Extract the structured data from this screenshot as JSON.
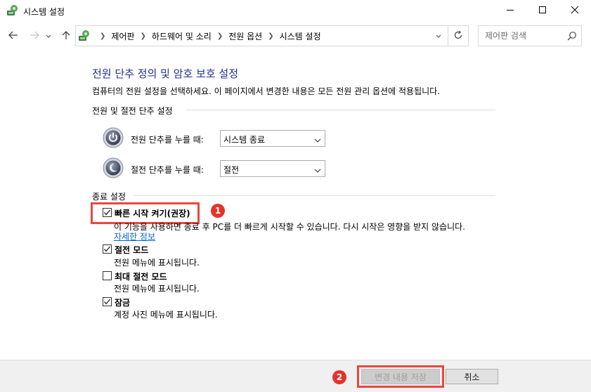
{
  "window": {
    "title": "시스템 설정",
    "app_icon": "control-panel-icon",
    "controls": [
      "minimize-icon",
      "maximize-icon",
      "close-icon"
    ]
  },
  "navigation": {
    "back_icon": "back-arrow-icon",
    "forward_icon": "forward-arrow-icon",
    "recent_icon": "chevron-down-icon",
    "up_icon": "up-arrow-icon",
    "breadcrumbs": [
      "제어판",
      "하드웨어 및 소리",
      "전원 옵션",
      "시스템 설정"
    ],
    "search_placeholder": "제어판 검색"
  },
  "content": {
    "heading": "전원 단추 정의 및 암호 보호 설정",
    "description": "컴퓨터의 전원 설정을 선택하세요. 이 페이지에서 변경한 내용은 모든 전원 관리 옵션에 적용됩니다.",
    "power_section": {
      "label": "전원 및 절전 단추 설정",
      "rows": [
        {
          "label": "전원 단추를 누를 때:",
          "value": "시스템 종료",
          "icon": "power-button-icon"
        },
        {
          "label": "절전 단추를 누를 때:",
          "value": "절전",
          "icon": "sleep-button-icon"
        }
      ]
    },
    "shutdown_section": {
      "label": "종료 설정",
      "options": [
        {
          "label": "빠른 시작 켜기(권장)",
          "checked": true,
          "desc": "이 기능을 사용하면 종료 후 PC를 더 빠르게 시작할 수 있습니다. 다시 시작은 영향을 받지 않습니다.",
          "link": "자세한 정보"
        },
        {
          "label": "절전 모드",
          "checked": true,
          "desc": "전원 메뉴에 표시됩니다."
        },
        {
          "label": "최대 절전 모드",
          "checked": false,
          "desc": "전원 메뉴에 표시됩니다."
        },
        {
          "label": "잠금",
          "checked": true,
          "desc": "계정 사진 메뉴에 표시됩니다."
        }
      ]
    }
  },
  "annotations": {
    "badge1": "1",
    "badge2": "2",
    "color": "#e5332a"
  },
  "footer": {
    "save_label": "변경 내용 저장",
    "cancel_label": "취소"
  }
}
